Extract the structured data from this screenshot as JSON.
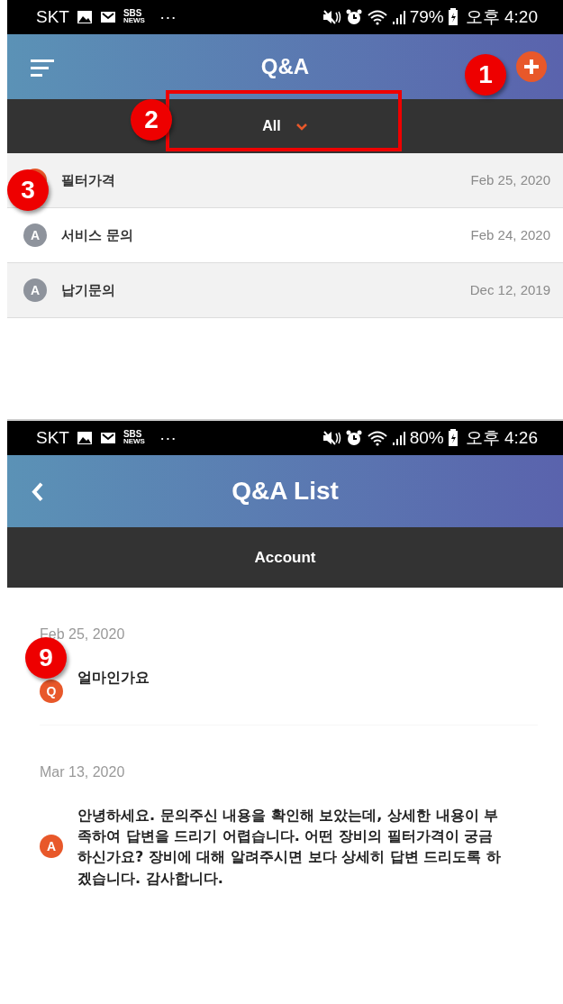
{
  "screens": [
    {
      "status_bar": {
        "carrier": "SKT",
        "news_logo": [
          "SBS",
          "NEWS"
        ],
        "more": "···",
        "battery": "79%",
        "time": "오후 4:20"
      },
      "header": {
        "title": "Q&A",
        "menu_button": true,
        "add_button": true
      },
      "filter": {
        "label": "All",
        "dropdown": true
      },
      "rows": [
        {
          "title": "필터가격",
          "date": "Feb 25, 2020",
          "color": "#e8582a"
        },
        {
          "title": "서비스 문의",
          "date": "Feb 24, 2020",
          "badge": "A",
          "color": "#8e939c"
        },
        {
          "title": "납기문의",
          "date": "Dec 12, 2019",
          "badge": "A",
          "color": "#8e939c"
        }
      ]
    },
    {
      "status_bar": {
        "carrier": "SKT",
        "news_logo": [
          "SBS",
          "NEWS"
        ],
        "more": "···",
        "battery": "80%",
        "time": "오후 4:26"
      },
      "header": {
        "title": "Q&A List",
        "back_button": true
      },
      "filter": {
        "label": "Account",
        "dropdown": false
      },
      "thread": [
        {
          "date": "Feb 25, 2020",
          "badge": "Q",
          "text": "얼마인가요"
        },
        {
          "date": "Mar 13, 2020",
          "badge": "A",
          "text": "안녕하세요. 문의주신 내용을 확인해 보았는데, 상세한 내용이 부족하여 답변을 드리기 어렵습니다. 어떤 장비의 필터가격이 궁금하신가요? 장비에 대해 알려주시면 보다 상세히 답변 드리도록 하겠습니다. 감사합니다."
        }
      ]
    }
  ],
  "annotations": [
    {
      "label": "1"
    },
    {
      "label": "2"
    },
    {
      "label": "3"
    },
    {
      "label": "9"
    }
  ]
}
